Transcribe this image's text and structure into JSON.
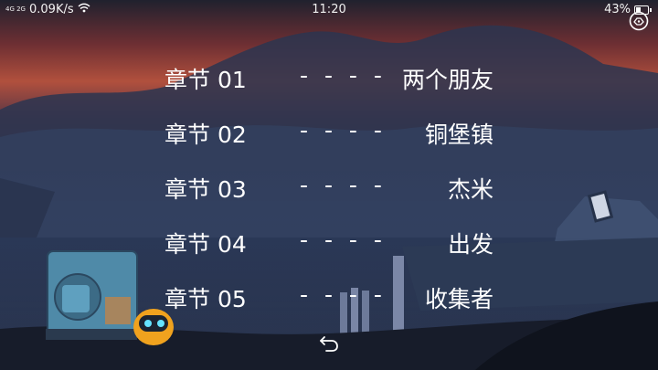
{
  "status_bar": {
    "network_type": "4G 2G",
    "speed": "0.09K/s",
    "time": "11:20",
    "battery": "43%",
    "battery_level": 0.43,
    "wifi_icon": "wifi-icon"
  },
  "chapters": [
    {
      "number": "章节 01",
      "separator": "- - - -",
      "title": "两个朋友"
    },
    {
      "number": "章节 02",
      "separator": "- - - -",
      "title": "铜堡镇"
    },
    {
      "number": "章节 03",
      "separator": "- - - -",
      "title": "杰米"
    },
    {
      "number": "章节 04",
      "separator": "- - - -",
      "title": "出发"
    },
    {
      "number": "章节 05",
      "separator": "- - - -",
      "title": "收集者"
    }
  ],
  "icons": {
    "back": "back-arrow-icon",
    "corner": "gamepad-bubble-icon"
  },
  "colors": {
    "sky_top": "#1a1f33",
    "sunset": "#a24a3c",
    "ground": "#1b2233"
  }
}
